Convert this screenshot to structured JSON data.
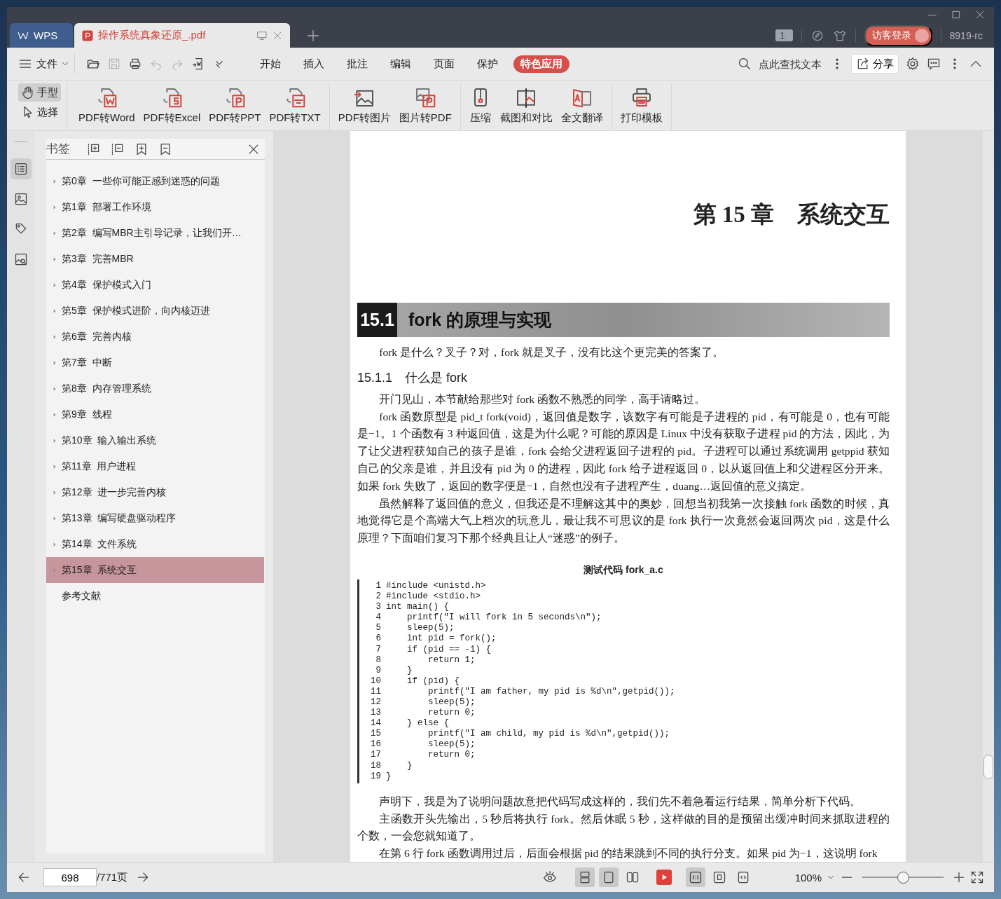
{
  "window": {
    "controls": [
      {
        "kind": "minimize"
      },
      {
        "kind": "maximize"
      },
      {
        "kind": "close"
      }
    ]
  },
  "tabs": [
    {
      "label": "WPS",
      "kind": "home",
      "selected": false
    },
    {
      "label": "操作系统真象还原_.pdf",
      "kind": "document",
      "selected": true
    }
  ],
  "title_bar": {
    "page_badge": "1",
    "login_button": "访客登录",
    "user_id": "8919-rc"
  },
  "menu": {
    "file": "文件",
    "quick_tools": [
      {
        "kind": "open",
        "disabled": false
      },
      {
        "kind": "save",
        "disabled": true
      },
      {
        "kind": "print",
        "disabled": false
      },
      {
        "kind": "undo",
        "disabled": true
      },
      {
        "kind": "redo",
        "disabled": true
      },
      {
        "kind": "export",
        "disabled": false
      },
      {
        "kind": "more",
        "disabled": false
      }
    ],
    "items": [
      {
        "label": "开始",
        "selected": false
      },
      {
        "label": "插入",
        "selected": false
      },
      {
        "label": "批注",
        "selected": false
      },
      {
        "label": "编辑",
        "selected": false
      },
      {
        "label": "页面",
        "selected": false
      },
      {
        "label": "保护",
        "selected": false
      },
      {
        "label": "特色应用",
        "selected": true
      }
    ],
    "search": {
      "placeholder": "点此查找文本"
    },
    "share": "分享"
  },
  "ribbon": {
    "modes": [
      {
        "label": "手型",
        "kind": "hand",
        "selected": true
      },
      {
        "label": "选择",
        "kind": "cursor",
        "selected": false
      }
    ],
    "groups": [
      [
        {
          "label": "PDF转Word",
          "kind": "to-word"
        },
        {
          "label": "PDF转Excel",
          "kind": "to-excel"
        },
        {
          "label": "PDF转PPT",
          "kind": "to-ppt"
        },
        {
          "label": "PDF转TXT",
          "kind": "to-txt"
        }
      ],
      [
        {
          "label": "PDF转图片",
          "kind": "to-image"
        },
        {
          "label": "图片转PDF",
          "kind": "from-image"
        }
      ],
      [
        {
          "label": "压缩",
          "kind": "compress"
        },
        {
          "label": "截图和对比",
          "kind": "compare"
        },
        {
          "label": "全文翻译",
          "kind": "translate"
        }
      ],
      [
        {
          "label": "打印模板",
          "kind": "print-template"
        }
      ]
    ]
  },
  "rail": [
    {
      "kind": "list",
      "selected": true
    },
    {
      "kind": "image",
      "selected": false
    },
    {
      "kind": "tag",
      "selected": false
    },
    {
      "kind": "image-search",
      "selected": false
    }
  ],
  "sidebar": {
    "title": "书签",
    "items": [
      {
        "label": "第0章  一些你可能正感到迷惑的问题",
        "expandable": true,
        "selected": false
      },
      {
        "label": "第1章  部署工作环境",
        "expandable": true,
        "selected": false
      },
      {
        "label": "第2章  编写MBR主引导记录，让我们开…",
        "expandable": true,
        "selected": false
      },
      {
        "label": "第3章  完善MBR",
        "expandable": true,
        "selected": false
      },
      {
        "label": "第4章  保护模式入门",
        "expandable": true,
        "selected": false
      },
      {
        "label": "第5章  保护模式进阶，向内核迈进",
        "expandable": true,
        "selected": false
      },
      {
        "label": "第6章  完善内核",
        "expandable": true,
        "selected": false
      },
      {
        "label": "第7章  中断",
        "expandable": true,
        "selected": false
      },
      {
        "label": "第8章  内存管理系统",
        "expandable": true,
        "selected": false
      },
      {
        "label": "第9章  线程",
        "expandable": true,
        "selected": false
      },
      {
        "label": "第10章  输入输出系统",
        "expandable": true,
        "selected": false
      },
      {
        "label": "第11章  用户进程",
        "expandable": true,
        "selected": false
      },
      {
        "label": "第12章  进一步完善内核",
        "expandable": true,
        "selected": false
      },
      {
        "label": "第13章  编写硬盘驱动程序",
        "expandable": true,
        "selected": false
      },
      {
        "label": "第14章  文件系统",
        "expandable": true,
        "selected": false
      },
      {
        "label": "第15章  系统交互",
        "expandable": true,
        "selected": true
      },
      {
        "label": "参考文献",
        "expandable": false,
        "selected": false
      }
    ]
  },
  "document": {
    "chapter_title": "第 15 章　系统交互",
    "section": {
      "number": "15.1",
      "title": "fork 的原理与实现"
    },
    "blocks": [
      {
        "kind": "paragraph",
        "text": "fork 是什么？叉子？对，fork 就是叉子，没有比这个更完美的答案了。"
      },
      {
        "kind": "heading",
        "text": "15.1.1　什么是 fork"
      },
      {
        "kind": "paragraph",
        "text": "开门见山，本节献给那些对 fork 函数不熟悉的同学，高手请略过。"
      },
      {
        "kind": "paragraph",
        "text": "fork 函数原型是 pid_t fork(void)，返回值是数字，该数字有可能是子进程的 pid，有可能是 0，也有可能是−1。1 个函数有 3 种返回值，这是为什么呢？可能的原因是 Linux 中没有获取子进程 pid 的方法，因此，为了让父进程获知自己的孩子是谁，fork 会给父进程返回子进程的 pid。子进程可以通过系统调用 getppid 获知自己的父亲是谁，并且没有 pid 为 0 的进程，因此 fork 给子进程返回 0，以从返回值上和父进程区分开来。如果 fork 失败了，返回的数字便是−1，自然也没有子进程产生，duang…返回值的意义搞定。"
      },
      {
        "kind": "paragraph",
        "text": "虽然解释了返回值的意义，但我还是不理解这其中的奥妙，回想当初我第一次接触 fork 函数的时候，真地觉得它是个高端大气上档次的玩意儿，最让我不可思议的是 fork 执行一次竟然会返回两次 pid，这是什么原理？下面咱们复习下那个经典且让人“迷惑”的例子。"
      },
      {
        "kind": "caption",
        "text": "测试代码 fork_a.c"
      },
      {
        "kind": "code",
        "lines": [
          {
            "number": "1",
            "code": "#include <unistd.h>"
          },
          {
            "number": "2",
            "code": "#include <stdio.h>"
          },
          {
            "number": "3",
            "code": "int main() {"
          },
          {
            "number": "4",
            "code": "    printf(\"I will fork in 5 seconds\\n\");"
          },
          {
            "number": "5",
            "code": "    sleep(5);"
          },
          {
            "number": "6",
            "code": "    int pid = fork();"
          },
          {
            "number": "7",
            "code": "    if (pid == -1) {"
          },
          {
            "number": "8",
            "code": "        return 1;"
          },
          {
            "number": "9",
            "code": "    }"
          },
          {
            "number": "10",
            "code": "    if (pid) {"
          },
          {
            "number": "11",
            "code": "        printf(\"I am father, my pid is %d\\n\",getpid());"
          },
          {
            "number": "12",
            "code": "        sleep(5);"
          },
          {
            "number": "13",
            "code": "        return 0;"
          },
          {
            "number": "14",
            "code": "    } else {"
          },
          {
            "number": "15",
            "code": "        printf(\"I am child, my pid is %d\\n\",getpid());"
          },
          {
            "number": "16",
            "code": "        sleep(5);"
          },
          {
            "number": "17",
            "code": "        return 0;"
          },
          {
            "number": "18",
            "code": "    }"
          },
          {
            "number": "19",
            "code": "}"
          }
        ]
      },
      {
        "kind": "paragraph",
        "text": "声明下，我是为了说明问题故意把代码写成这样的，我们先不着急看运行结果，简单分析下代码。"
      },
      {
        "kind": "paragraph",
        "text": "主函数开头先输出，5 秒后将执行 fork。然后休眠 5 秒，这样做的目的是预留出缓冲时间来抓取进程的个数，一会您就知道了。"
      },
      {
        "kind": "paragraph",
        "text": "在第 6 行 fork 函数调用过后，后面会根据 pid 的结果跳到不同的执行分支。如果 pid 为−1，这说明 fork"
      }
    ]
  },
  "status_bar": {
    "page": "698",
    "total": "/771页",
    "view_modes": [
      {
        "kind": "continuous",
        "selected": true
      },
      {
        "kind": "single",
        "selected": true
      },
      {
        "kind": "double",
        "selected": false
      }
    ],
    "fit_modes": [
      {
        "kind": "actual",
        "selected": true
      },
      {
        "kind": "fit-page",
        "selected": false
      },
      {
        "kind": "fit-width",
        "selected": false
      }
    ],
    "zoom": "100%",
    "zoom_slider": {
      "level": 0.5
    }
  }
}
